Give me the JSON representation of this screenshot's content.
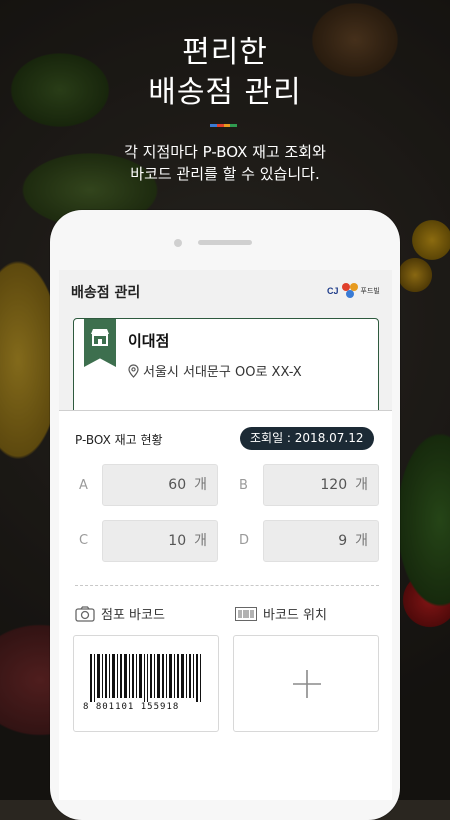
{
  "header": {
    "headline_line1": "편리한",
    "headline_line2": "배송점 관리",
    "accent_colors": [
      "#3a7bd5",
      "#e0402c",
      "#e79a1e",
      "#2f9a4f"
    ],
    "sub_line1": "각 지점마다 P-BOX 재고 조회와",
    "sub_line2": "바코드 관리를 할 수 있습니다."
  },
  "screen": {
    "title": "배송점 관리",
    "brand": {
      "cj": "CJ",
      "sub": "푸드빌",
      "logo_icon": "cj-logo-icon"
    },
    "store": {
      "name": "이대점",
      "address": "서울시 서대문구 OO로 XX-X",
      "badge_icon": "store-icon",
      "pin_icon": "location-pin-icon"
    },
    "inventory": {
      "title": "P-BOX 재고 현황",
      "date_label": "조회일 : 2018.07.12",
      "unit": "개",
      "cells": [
        {
          "label": "A",
          "value": "60"
        },
        {
          "label": "B",
          "value": "120"
        },
        {
          "label": "C",
          "value": "10"
        },
        {
          "label": "D",
          "value": "9"
        }
      ]
    },
    "barcode": {
      "store_label": "점포 바코드",
      "store_icon": "camera-icon",
      "location_label": "바코드 위치",
      "location_icon": "barcode-icon",
      "number": "8 801101 155918",
      "add_icon": "plus-icon"
    }
  },
  "colors": {
    "badge_green": "#3d6f4e",
    "pill_dark": "#1c2a35"
  }
}
